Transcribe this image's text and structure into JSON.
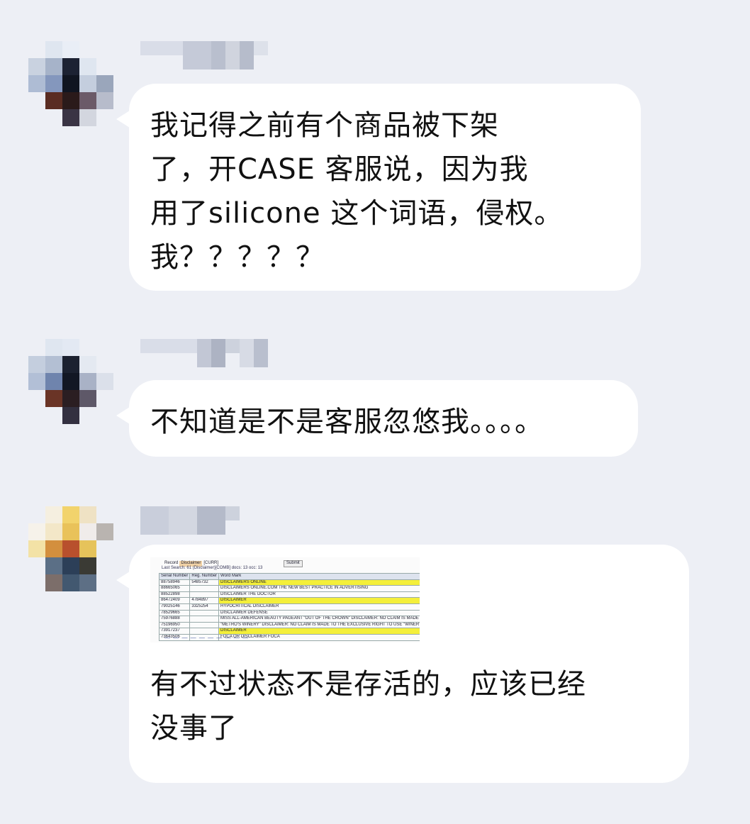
{
  "messages": [
    {
      "sender_name": "",
      "text": "我记得之前有个商品被下架\n了，开CASE 客服说，因为我\n用了silicone 这个词语，侵权。\n我？？？？？"
    },
    {
      "sender_name": "",
      "text": "不知道是不是客服忽悠我。。。。"
    },
    {
      "sender_name": "",
      "text": "有不过状态不是存活的，应该已经\n没事了",
      "attachment": {
        "search_term": "Disclaimer",
        "search_label": "Record",
        "search_extra": "[CURR]",
        "go_label": "Submit",
        "result_line": "Last Search: 61  (Disclaimer)[COMB]  docs: 13  occ: 13",
        "columns": [
          "Serial Number",
          "Reg. Number",
          "Word Mark"
        ],
        "rows": [
          [
            "88758946",
            "5485732",
            "DISCLAIMERS ONLINE"
          ],
          [
            "88665065",
            "",
            "DISCLAIMERS ONLINE.COM THE NEW BEST PRACTICE IN ADVERTISING"
          ],
          [
            "88522898",
            "",
            "DISCLAIMER THE DOCTOR"
          ],
          [
            "86472409",
            "4784897",
            "DISCLAIMER"
          ],
          [
            "79025146",
            "3325254",
            "HYPOCRITICAL DISCLAIMER"
          ],
          [
            "78529665",
            "",
            "DISCLAIMER DEFENSE"
          ],
          [
            "75976888",
            "",
            "MISS ALL-AMERICAN BEAUTY PAGEANT \"OUT OF THE CROWN\" DISCLAIMER: NO CLAIM IS MADE TO"
          ],
          [
            "75196950",
            "",
            "\"METRO'S WINERY\" DISCLAIMER: NO CLAIM IS MADE TO THE EXCLUSIVE RIGHT TO USE \"WINERY\" A"
          ],
          [
            "73917237",
            "",
            "DISCLAIMER"
          ],
          [
            "73643506",
            "",
            "FOCA OR DISCLAIMER FOCA"
          ]
        ],
        "pager": "— — — — — — — — — —"
      }
    }
  ]
}
